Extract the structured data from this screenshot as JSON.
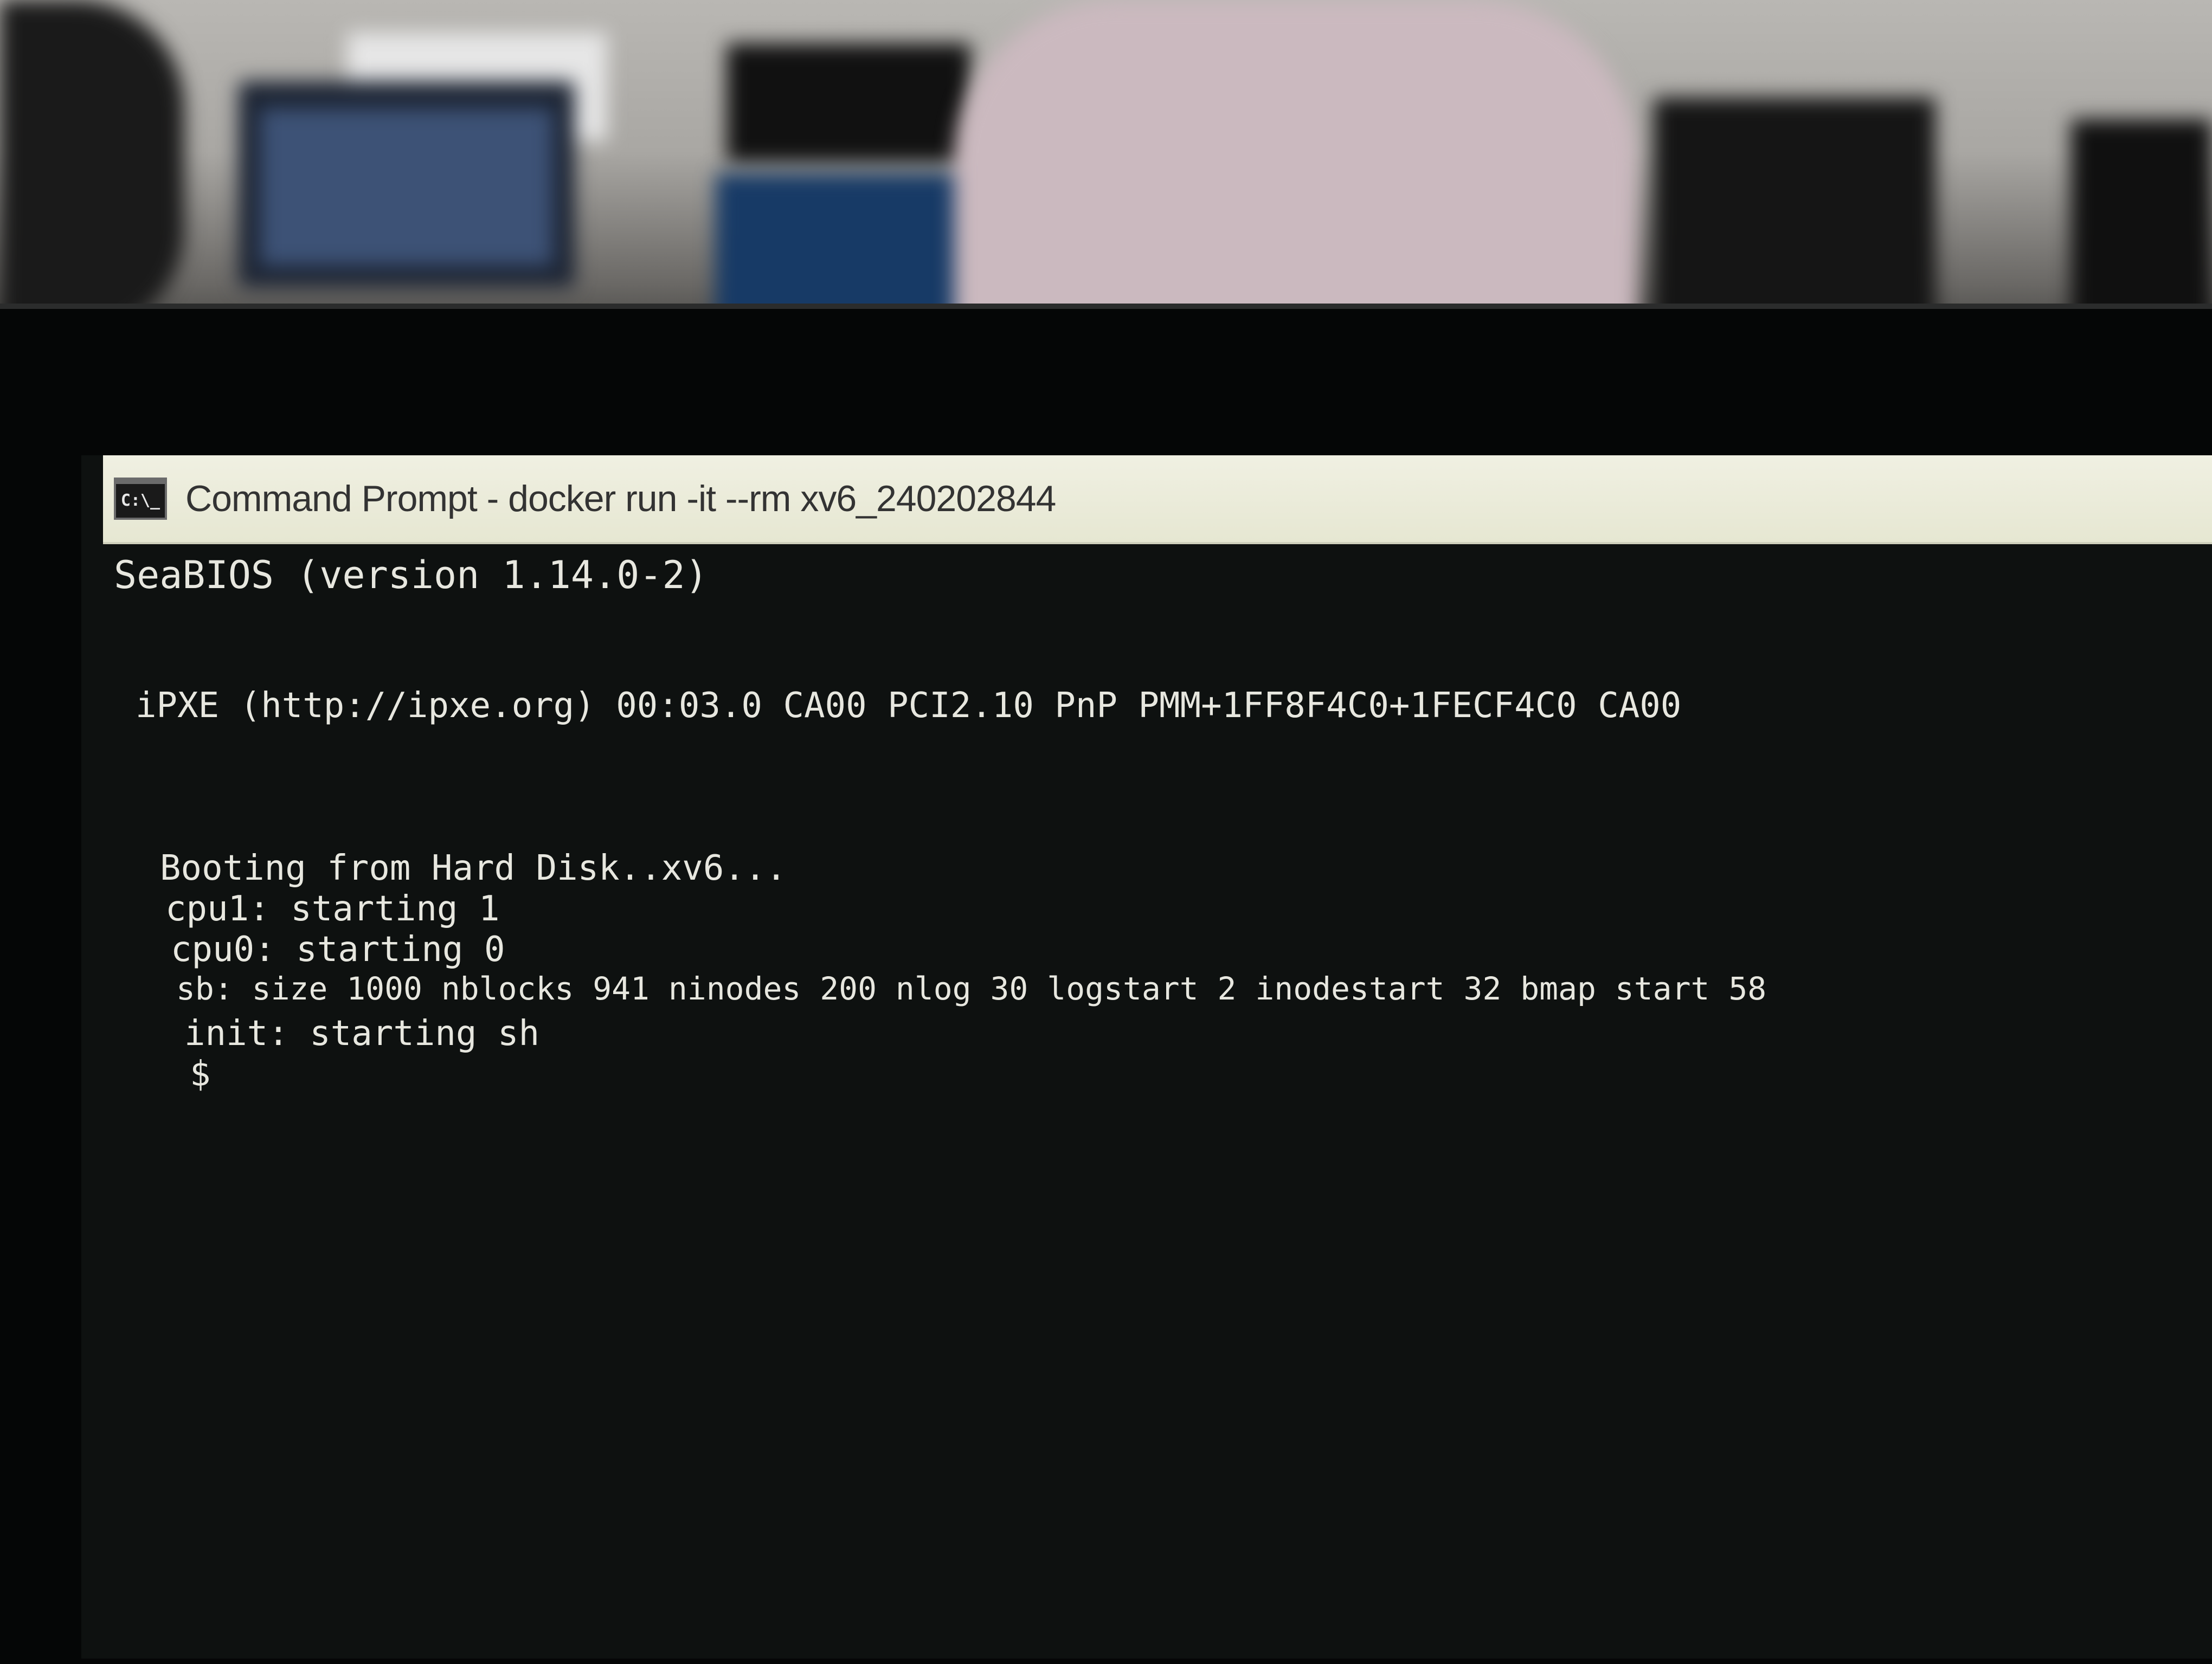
{
  "window": {
    "title": "Command Prompt - docker  run -it --rm xv6_240202844",
    "icon_label": "C:\\_",
    "icon": "command-prompt-icon"
  },
  "terminal": {
    "lines": [
      "SeaBIOS (version 1.14.0-2)",
      "iPXE (http://ipxe.org) 00:03.0 CA00 PCI2.10 PnP PMM+1FF8F4C0+1FECF4C0 CA00",
      "Booting from Hard Disk..xv6...",
      "cpu1: starting 1",
      "cpu0: starting 0",
      "sb: size 1000 nblocks 941 ninodes 200 nlog 30 logstart 2 inodestart 32 bmap start 58",
      "init: starting sh",
      "$"
    ]
  },
  "colors": {
    "terminal_background": "#0e1110",
    "terminal_text": "#e7e7df",
    "titlebar_background": "#eeeedd"
  }
}
